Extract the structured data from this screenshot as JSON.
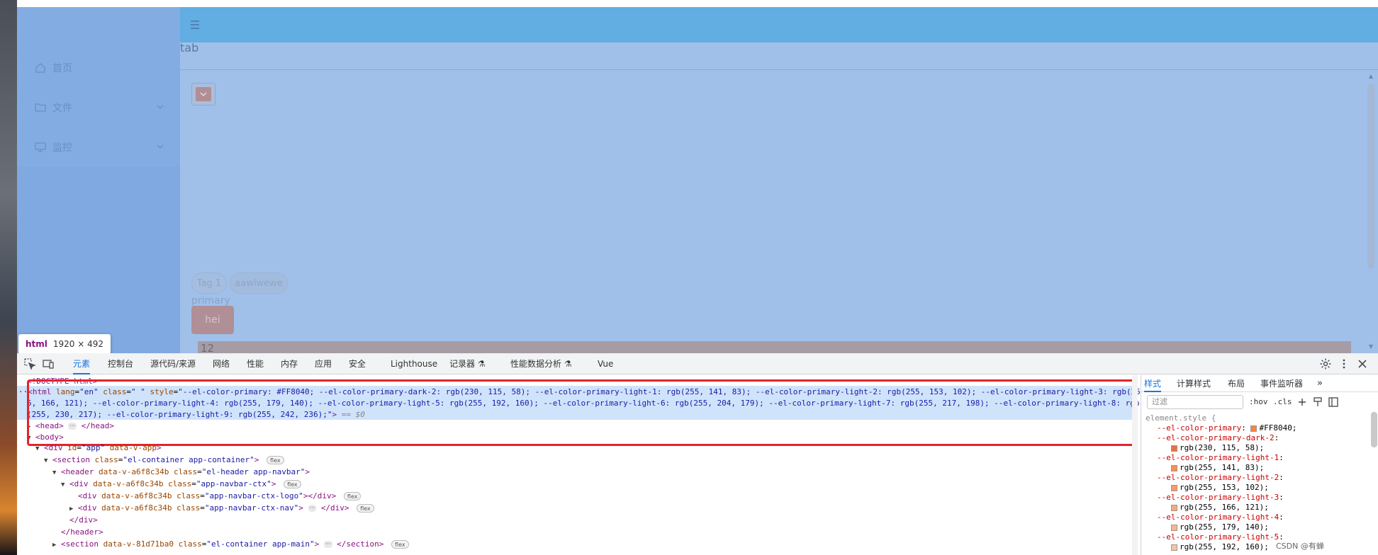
{
  "app": {
    "menu": [
      {
        "label": "首页",
        "icon": "house-icon",
        "has_children": false
      },
      {
        "label": "文件",
        "icon": "folder-icon",
        "has_children": true
      },
      {
        "label": "监控",
        "icon": "monitor-icon",
        "has_children": true
      }
    ],
    "tab_text": "tab",
    "tags": [
      "Tag 1",
      "aawlwewe"
    ],
    "primary_text": "primary",
    "hei_button": "hei",
    "number_bar": "12"
  },
  "inspect_tip": {
    "tag": "html",
    "size": "1920 × 492"
  },
  "devtools": {
    "tabs": [
      "元素",
      "控制台",
      "源代码/来源",
      "网络",
      "性能",
      "内存",
      "应用",
      "安全",
      "Lighthouse",
      "记录器 ⚗",
      "性能数据分析 ⚗",
      "Vue"
    ],
    "active_tab": "元素",
    "dom": {
      "doctype": "<!DOCTYPE html>",
      "html_line1": "\"--el-color-primary: #FF8040; --el-color-primary-dark-2: rgb(230, 115, 58); --el-color-primary-light-1: rgb(255, 141, 83); --el-color-primary-light-2: rgb(255, 153, 102); --el-color-primary-light-3: rgb(25",
      "html_line2": "5, 166, 121); --el-color-primary-light-4: rgb(255, 179, 140); --el-color-primary-light-5: rgb(255, 192, 160); --el-color-primary-light-6: rgb(255, 204, 179); --el-color-primary-light-7: rgb(255, 217, 198); --el-color-primary-light-8: rgb",
      "html_line3": "(255, 230, 217); --el-color-primary-light-9: rgb(255, 242, 236);\"",
      "dollar0": "== $0",
      "head_open": "<head>",
      "head_close": "</head>",
      "body_open": "<body>",
      "app_div": "div",
      "app_div_rest": "data-v-app",
      "section1_class": "\"el-container app-container\"",
      "header_attrs": "data-v-a6f8c34b",
      "header_class": "\"el-header app-navbar\"",
      "ctx_class": "\"app-navbar-ctx\"",
      "logo_class": "\"app-navbar-ctx-logo\"",
      "nav_class": "\"app-navbar-ctx-nav\"",
      "div_close": "</div>",
      "header_close": "</header>",
      "section2_attr": "data-v-81d71ba0",
      "section2_class": "\"el-container app-main\"",
      "section_close": "</section>",
      "flex_pill": "flex"
    },
    "styles": {
      "tabs": [
        "样式",
        "计算样式",
        "布局",
        "事件监听器"
      ],
      "active_tab": "样式",
      "filter_placeholder": "过滤",
      "hov": ":hov",
      "cls": ".cls",
      "selector": "element.style {",
      "props": [
        {
          "name": "--el-color-primary",
          "value": "#FF8040",
          "inline": true
        },
        {
          "name": "--el-color-primary-dark-2",
          "value": "rgb(230, 115, 58);"
        },
        {
          "name": "--el-color-primary-light-1",
          "value": "rgb(255, 141, 83);"
        },
        {
          "name": "--el-color-primary-light-2",
          "value": "rgb(255, 153, 102);"
        },
        {
          "name": "--el-color-primary-light-3",
          "value": "rgb(255, 166, 121);"
        },
        {
          "name": "--el-color-primary-light-4",
          "value": "rgb(255, 179, 140);"
        },
        {
          "name": "--el-color-primary-light-5",
          "value": "rgb(255, 192, 160);"
        }
      ]
    }
  },
  "colors": {
    "primary": "#FF8040",
    "dark_2": "#e6733a",
    "light_1": "#ff8d53",
    "light_2": "#ff9966",
    "light_3": "#ffa679",
    "light_4": "#ffb38c",
    "light_5": "#ffc0a0",
    "navbar": "#4bc6e6",
    "devtools_accent": "#1a73e8",
    "highlight_border": "#e1242b"
  },
  "watermark": "CSDN @有蝉"
}
